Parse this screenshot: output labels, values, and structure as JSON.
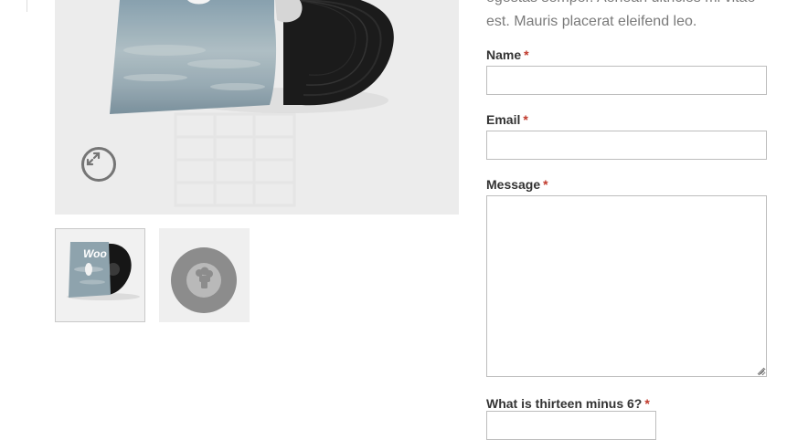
{
  "product": {
    "main_image_alt": "Vinyl album product image",
    "zoom_icon": "expand-arrows-icon",
    "thumbnails": [
      {
        "icon": "woo-album-thumbnail",
        "label": "Woo"
      },
      {
        "icon": "placeholder-record-thumbnail"
      }
    ]
  },
  "description": {
    "line_top": "egestas semper. Aenean ultricies mi vitae",
    "line": "est. Mauris placerat eleifend leo."
  },
  "form": {
    "required_mark": "*",
    "name_label": "Name",
    "email_label": "Email",
    "message_label": "Message",
    "captcha_label": "What is thirteen minus 6?",
    "name_value": "",
    "email_value": "",
    "message_value": "",
    "captcha_value": ""
  },
  "colors": {
    "required": "#c0392b",
    "input_border": "#bdbdbd",
    "description_text": "#7a7a7a"
  }
}
